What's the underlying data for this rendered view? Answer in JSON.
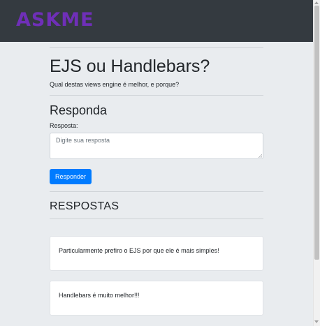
{
  "brand": "ASKME",
  "question": {
    "title": "EJS ou Handlebars?",
    "description": "Qual destas views engine é melhor, e porque?"
  },
  "reply_form": {
    "heading": "Responda",
    "label": "Resposta:",
    "placeholder": "Digite sua resposta",
    "value": "",
    "submit_label": "Responder"
  },
  "answers": {
    "heading": "RESPOSTAS",
    "items": [
      {
        "text": "Particularmente prefiro o EJS por que ele é mais simples!"
      },
      {
        "text": "Handlebars é muito melhor!!!"
      }
    ]
  },
  "colors": {
    "brand": "#6f2fb8",
    "navbar": "#343a40",
    "page_background": "#e9ecef",
    "primary_button": "#007bff"
  }
}
